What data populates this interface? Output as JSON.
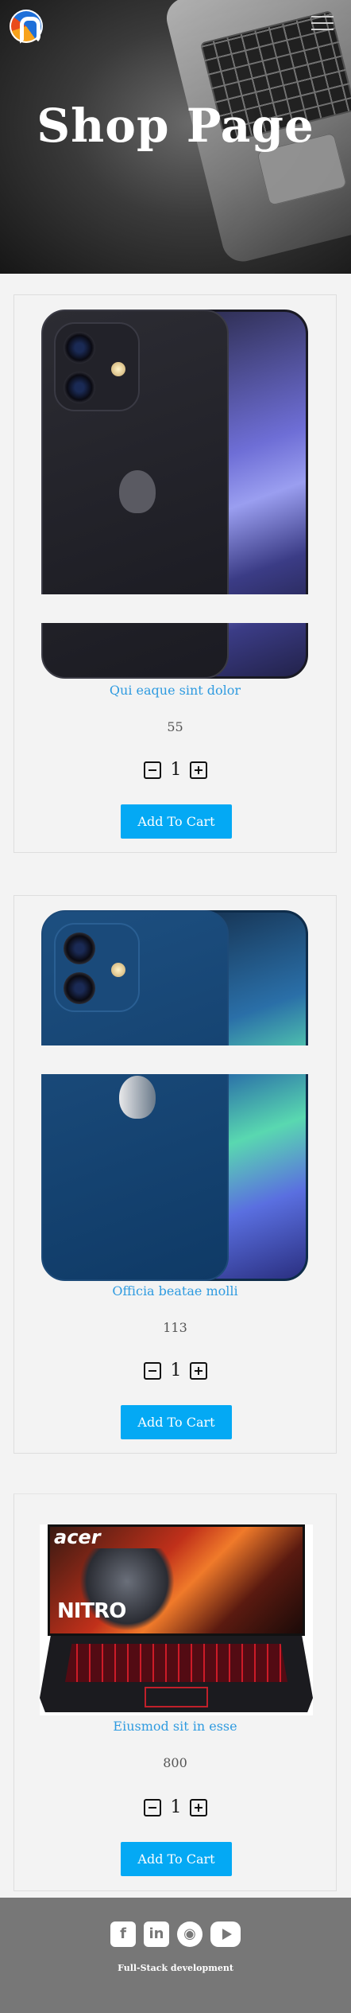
{
  "hero": {
    "title": "Shop Page"
  },
  "products": [
    {
      "name": "Qui eaque sint dolor",
      "price": "55",
      "quantity": "1",
      "cart_label": "Add To Cart",
      "image": "iphone-12-black"
    },
    {
      "name": "Officia beatae molli",
      "price": "113",
      "quantity": "1",
      "cart_label": "Add To Cart",
      "image": "iphone-12-blue"
    },
    {
      "name": "Eiusmod sit in esse",
      "price": "800",
      "quantity": "1",
      "cart_label": "Add To Cart",
      "image": "acer-nitro-laptop"
    }
  ],
  "image_text": {
    "laptop_brand": "acer",
    "laptop_model": "NITRO"
  },
  "footer": {
    "icons": [
      "facebook-icon",
      "linkedin-icon",
      "github-icon",
      "youtube-icon"
    ],
    "text": "Full-Stack development"
  },
  "colors": {
    "accent": "#04a9f4",
    "name_link": "#2f9be0",
    "footer_bg": "#777777",
    "page_bg": "#f3f3f3"
  }
}
